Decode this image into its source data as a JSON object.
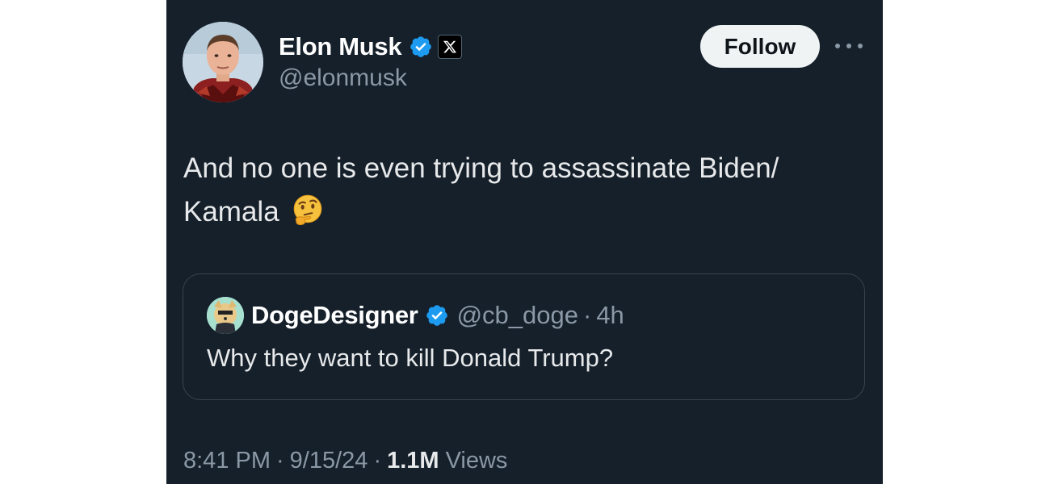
{
  "author": {
    "display_name": "Elon Musk",
    "handle": "@elonmusk",
    "verified": true,
    "affiliation_badge": "X"
  },
  "actions": {
    "follow_label": "Follow",
    "more_icon": "more-horizontal-icon"
  },
  "tweet": {
    "text_line1": "And no one is even trying to assassinate Biden/",
    "text_line2": "Kamala",
    "emoji": "thinking-face-emoji"
  },
  "quoted_tweet": {
    "display_name": "DogeDesigner",
    "handle": "@cb_doge",
    "separator": "·",
    "time": "4h",
    "text": "Why they want to kill Donald Trump?",
    "verified": true
  },
  "meta": {
    "time": "8:41 PM",
    "date": "9/15/24",
    "separator": "·",
    "views_count": "1.1M",
    "views_label": "Views"
  },
  "colors": {
    "background": "#15202b",
    "verified_blue": "#1d9bf0",
    "secondary_text": "#8b98a5",
    "follow_button": "#eff3f4"
  }
}
